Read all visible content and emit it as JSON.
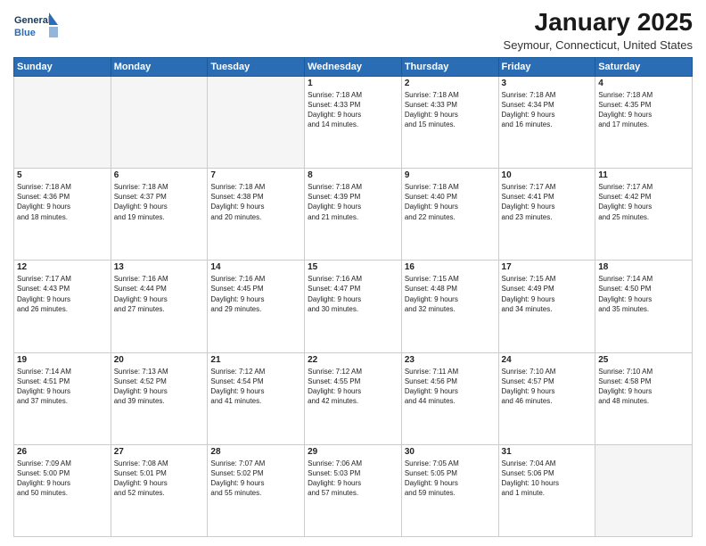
{
  "header": {
    "logo_line1": "General",
    "logo_line2": "Blue",
    "title": "January 2025",
    "subtitle": "Seymour, Connecticut, United States"
  },
  "weekdays": [
    "Sunday",
    "Monday",
    "Tuesday",
    "Wednesday",
    "Thursday",
    "Friday",
    "Saturday"
  ],
  "weeks": [
    [
      {
        "day": "",
        "info": ""
      },
      {
        "day": "",
        "info": ""
      },
      {
        "day": "",
        "info": ""
      },
      {
        "day": "1",
        "info": "Sunrise: 7:18 AM\nSunset: 4:33 PM\nDaylight: 9 hours\nand 14 minutes."
      },
      {
        "day": "2",
        "info": "Sunrise: 7:18 AM\nSunset: 4:33 PM\nDaylight: 9 hours\nand 15 minutes."
      },
      {
        "day": "3",
        "info": "Sunrise: 7:18 AM\nSunset: 4:34 PM\nDaylight: 9 hours\nand 16 minutes."
      },
      {
        "day": "4",
        "info": "Sunrise: 7:18 AM\nSunset: 4:35 PM\nDaylight: 9 hours\nand 17 minutes."
      }
    ],
    [
      {
        "day": "5",
        "info": "Sunrise: 7:18 AM\nSunset: 4:36 PM\nDaylight: 9 hours\nand 18 minutes."
      },
      {
        "day": "6",
        "info": "Sunrise: 7:18 AM\nSunset: 4:37 PM\nDaylight: 9 hours\nand 19 minutes."
      },
      {
        "day": "7",
        "info": "Sunrise: 7:18 AM\nSunset: 4:38 PM\nDaylight: 9 hours\nand 20 minutes."
      },
      {
        "day": "8",
        "info": "Sunrise: 7:18 AM\nSunset: 4:39 PM\nDaylight: 9 hours\nand 21 minutes."
      },
      {
        "day": "9",
        "info": "Sunrise: 7:18 AM\nSunset: 4:40 PM\nDaylight: 9 hours\nand 22 minutes."
      },
      {
        "day": "10",
        "info": "Sunrise: 7:17 AM\nSunset: 4:41 PM\nDaylight: 9 hours\nand 23 minutes."
      },
      {
        "day": "11",
        "info": "Sunrise: 7:17 AM\nSunset: 4:42 PM\nDaylight: 9 hours\nand 25 minutes."
      }
    ],
    [
      {
        "day": "12",
        "info": "Sunrise: 7:17 AM\nSunset: 4:43 PM\nDaylight: 9 hours\nand 26 minutes."
      },
      {
        "day": "13",
        "info": "Sunrise: 7:16 AM\nSunset: 4:44 PM\nDaylight: 9 hours\nand 27 minutes."
      },
      {
        "day": "14",
        "info": "Sunrise: 7:16 AM\nSunset: 4:45 PM\nDaylight: 9 hours\nand 29 minutes."
      },
      {
        "day": "15",
        "info": "Sunrise: 7:16 AM\nSunset: 4:47 PM\nDaylight: 9 hours\nand 30 minutes."
      },
      {
        "day": "16",
        "info": "Sunrise: 7:15 AM\nSunset: 4:48 PM\nDaylight: 9 hours\nand 32 minutes."
      },
      {
        "day": "17",
        "info": "Sunrise: 7:15 AM\nSunset: 4:49 PM\nDaylight: 9 hours\nand 34 minutes."
      },
      {
        "day": "18",
        "info": "Sunrise: 7:14 AM\nSunset: 4:50 PM\nDaylight: 9 hours\nand 35 minutes."
      }
    ],
    [
      {
        "day": "19",
        "info": "Sunrise: 7:14 AM\nSunset: 4:51 PM\nDaylight: 9 hours\nand 37 minutes."
      },
      {
        "day": "20",
        "info": "Sunrise: 7:13 AM\nSunset: 4:52 PM\nDaylight: 9 hours\nand 39 minutes."
      },
      {
        "day": "21",
        "info": "Sunrise: 7:12 AM\nSunset: 4:54 PM\nDaylight: 9 hours\nand 41 minutes."
      },
      {
        "day": "22",
        "info": "Sunrise: 7:12 AM\nSunset: 4:55 PM\nDaylight: 9 hours\nand 42 minutes."
      },
      {
        "day": "23",
        "info": "Sunrise: 7:11 AM\nSunset: 4:56 PM\nDaylight: 9 hours\nand 44 minutes."
      },
      {
        "day": "24",
        "info": "Sunrise: 7:10 AM\nSunset: 4:57 PM\nDaylight: 9 hours\nand 46 minutes."
      },
      {
        "day": "25",
        "info": "Sunrise: 7:10 AM\nSunset: 4:58 PM\nDaylight: 9 hours\nand 48 minutes."
      }
    ],
    [
      {
        "day": "26",
        "info": "Sunrise: 7:09 AM\nSunset: 5:00 PM\nDaylight: 9 hours\nand 50 minutes."
      },
      {
        "day": "27",
        "info": "Sunrise: 7:08 AM\nSunset: 5:01 PM\nDaylight: 9 hours\nand 52 minutes."
      },
      {
        "day": "28",
        "info": "Sunrise: 7:07 AM\nSunset: 5:02 PM\nDaylight: 9 hours\nand 55 minutes."
      },
      {
        "day": "29",
        "info": "Sunrise: 7:06 AM\nSunset: 5:03 PM\nDaylight: 9 hours\nand 57 minutes."
      },
      {
        "day": "30",
        "info": "Sunrise: 7:05 AM\nSunset: 5:05 PM\nDaylight: 9 hours\nand 59 minutes."
      },
      {
        "day": "31",
        "info": "Sunrise: 7:04 AM\nSunset: 5:06 PM\nDaylight: 10 hours\nand 1 minute."
      },
      {
        "day": "",
        "info": ""
      }
    ]
  ]
}
